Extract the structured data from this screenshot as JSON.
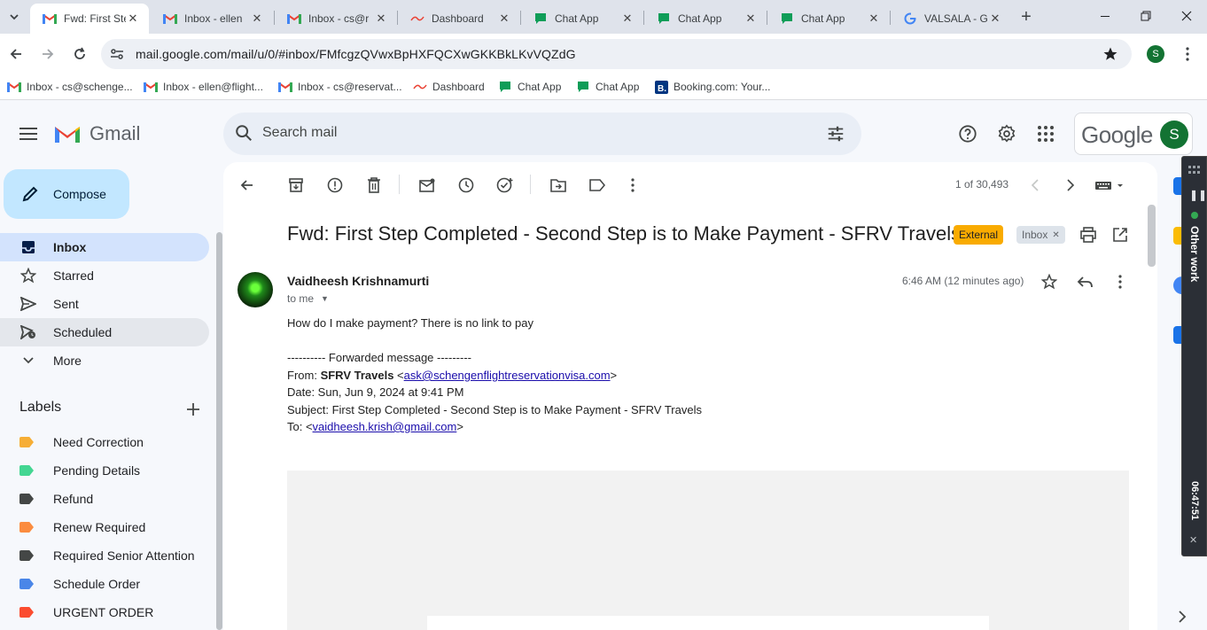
{
  "tabs": [
    {
      "title": "Fwd: First Ste",
      "icon": "gmail-icon",
      "active": true
    },
    {
      "title": "Inbox - ellen",
      "icon": "gmail-icon",
      "active": false
    },
    {
      "title": "Inbox - cs@r",
      "icon": "gmail-icon",
      "active": false
    },
    {
      "title": "Dashboard",
      "icon": "dashboard-icon",
      "active": false
    },
    {
      "title": "Chat App",
      "icon": "chat-icon",
      "active": false
    },
    {
      "title": "Chat App",
      "icon": "chat-icon",
      "active": false
    },
    {
      "title": "Chat App",
      "icon": "chat-icon",
      "active": false
    },
    {
      "title": "VALSALA - G",
      "icon": "google-icon",
      "active": false
    }
  ],
  "address": {
    "url": "mail.google.com/mail/u/0/#inbox/FMfcgzQVwxBpHXFQCXwGKKBkLKvVQZdG",
    "profile_initial": "S"
  },
  "bookmarks": [
    {
      "label": "Inbox - cs@schenge...",
      "icon": "gmail-icon"
    },
    {
      "label": "Inbox - ellen@flight...",
      "icon": "gmail-icon"
    },
    {
      "label": "Inbox - cs@reservat...",
      "icon": "gmail-icon"
    },
    {
      "label": "Dashboard",
      "icon": "dashboard-icon"
    },
    {
      "label": "Chat App",
      "icon": "chat-icon"
    },
    {
      "label": "Chat App",
      "icon": "chat-icon"
    },
    {
      "label": "Booking.com: Your...",
      "icon": "booking-icon"
    }
  ],
  "gmail": {
    "logo_text": "Gmail",
    "search_placeholder": "Search mail",
    "google_word": "Google",
    "account_initial": "S"
  },
  "nav": {
    "compose": "Compose",
    "items": [
      "Inbox",
      "Starred",
      "Sent",
      "Scheduled",
      "More"
    ],
    "labels_heading": "Labels",
    "labels": [
      {
        "name": "Need Correction",
        "color": "#f6ae35"
      },
      {
        "name": "Pending Details",
        "color": "#43d692"
      },
      {
        "name": "Refund",
        "color": "#444746"
      },
      {
        "name": "Renew Required",
        "color": "#fb8c3f"
      },
      {
        "name": "Required Senior Attention",
        "color": "#444746"
      },
      {
        "name": "Schedule Order",
        "color": "#4a86e8"
      },
      {
        "name": "URGENT ORDER",
        "color": "#fb4c2f"
      }
    ]
  },
  "message": {
    "pager": "1 of 30,493",
    "subject": "Fwd: First Step Completed - Second Step is to Make Payment - SFRV Travels",
    "chip_external": "External",
    "chip_inbox": "Inbox",
    "sender": "Vaidheesh Krishnamurti",
    "to": "to me",
    "time": "6:46 AM (12 minutes ago)",
    "body": {
      "line1": "How do I make payment?  There is no link to pay",
      "fwd_header": "---------- Forwarded message ---------",
      "from_label": "From: ",
      "from_name": "SFRV Travels",
      "from_email": "ask@schengenflightreservationvisa.com",
      "date": "Date: Sun, Jun 9, 2024 at 9:41 PM",
      "subject": "Subject: First Step Completed - Second Step is to Make Payment - SFRV Travels",
      "to_label": "To: <",
      "to_email": "vaidheesh.krish@gmail.com"
    }
  },
  "widget": {
    "label": "Other work",
    "timer": "06:47:51"
  }
}
